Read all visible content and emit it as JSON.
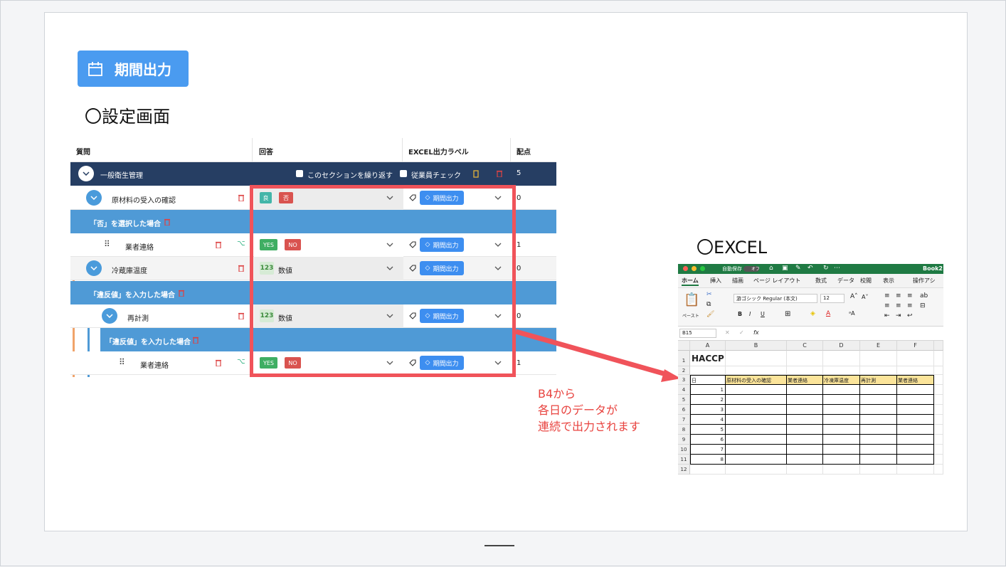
{
  "page": {
    "period_button_label": "期間出力",
    "settings_heading": "〇設定画面",
    "excel_heading": "〇EXCEL",
    "note_lines": [
      "B4から",
      "各日のデータが",
      "連続で出力されます"
    ]
  },
  "settings_table": {
    "headers": [
      "質問",
      "回答",
      "EXCEL出力ラベル",
      "配点"
    ],
    "section": {
      "title": "一般衛生管理",
      "repeat_label": "このセクションを繰り返す",
      "staff_check_label": "従業員チェック",
      "score": "5"
    },
    "rows": [
      {
        "type": "question",
        "label": "原材料の受入の確認",
        "answer_tags": [
          "良",
          "否"
        ],
        "excel_label": "期間出力",
        "score": "0"
      },
      {
        "type": "condition",
        "label": "「否」を選択した場合"
      },
      {
        "type": "question",
        "label": "業者連絡",
        "answer_tags": [
          "YES",
          "NO"
        ],
        "excel_label": "期間出力",
        "score": "1"
      },
      {
        "type": "question",
        "label": "冷蔵庫温度",
        "answer_text": "数値",
        "excel_label": "期間出力",
        "score": "0"
      },
      {
        "type": "condition",
        "label": "「違反値」を入力した場合"
      },
      {
        "type": "question",
        "label": "再計測",
        "answer_text": "数値",
        "excel_label": "期間出力",
        "score": "0"
      },
      {
        "type": "condition",
        "label": "「違反値」を入力した場合"
      },
      {
        "type": "question",
        "label": "業者連絡",
        "answer_tags": [
          "YES",
          "NO"
        ],
        "excel_label": "期間出力",
        "score": "1"
      }
    ],
    "colors": {
      "section_bg": "#263e63",
      "condition_bg": "#4f9ad6",
      "label_bg": "#3d8ef0",
      "yes": "#3fae63",
      "no": "#d9534f",
      "good": "#43b6a9",
      "bad": "#d9534f",
      "highlight": "#f0535a"
    }
  },
  "excel": {
    "autosave_label": "自動保存",
    "autosave_state": "オフ",
    "book_name": "Book2",
    "menu": [
      "ホーム",
      "挿入",
      "描画",
      "ページ レイアウト",
      "数式",
      "データ",
      "校閲",
      "表示",
      "操作アシ"
    ],
    "font_name": "游ゴシック Regular (本文)",
    "font_size": "12",
    "paste_label": "ペースト",
    "name_box": "B15",
    "fx_label": "fx",
    "columns": [
      "A",
      "B",
      "C",
      "D",
      "E",
      "F"
    ],
    "row_numbers": [
      "1",
      "2",
      "3",
      "4",
      "5",
      "6",
      "7",
      "8",
      "9",
      "10",
      "11",
      "12"
    ],
    "title": "HACCP",
    "header_row": [
      "日",
      "原材料の受入の確認",
      "業者連絡",
      "冷凍庫温度",
      "再計測",
      "業者連絡"
    ],
    "days": [
      "1",
      "2",
      "3",
      "4",
      "5",
      "6",
      "7",
      "8"
    ]
  }
}
